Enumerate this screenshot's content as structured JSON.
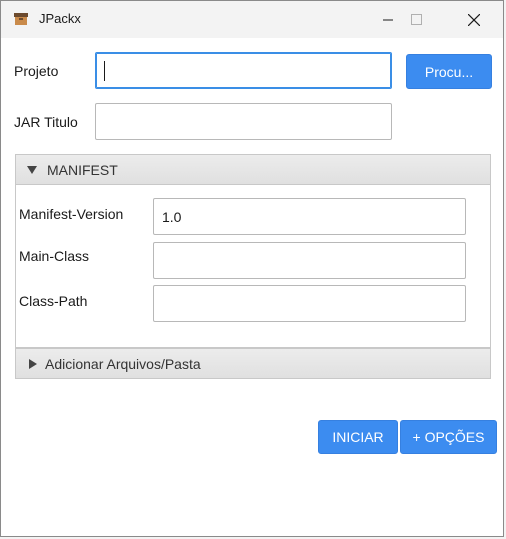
{
  "window": {
    "title": "JPackx",
    "icon": "app-box-icon",
    "controls": [
      "minimize",
      "maximize",
      "close"
    ]
  },
  "form": {
    "projeto_label": "Projeto",
    "projeto_value": "",
    "procurar_label": "Procu...",
    "jar_titulo_label": "JAR Titulo",
    "jar_titulo_value": ""
  },
  "manifest": {
    "title": "MANIFEST",
    "expanded": true,
    "fields": [
      {
        "label": "Manifest-Version",
        "value": "1.0"
      },
      {
        "label": "Main-Class",
        "value": ""
      },
      {
        "label": "Class-Path",
        "value": ""
      }
    ]
  },
  "arquivos": {
    "title": "Adicionar Arquivos/Pasta",
    "expanded": false
  },
  "actions": {
    "iniciar_label": "INICIAR",
    "opcoes_label": "+ OPÇÕES"
  },
  "colors": {
    "accent": "#3c8cf0",
    "focus": "#3a8ee6"
  }
}
